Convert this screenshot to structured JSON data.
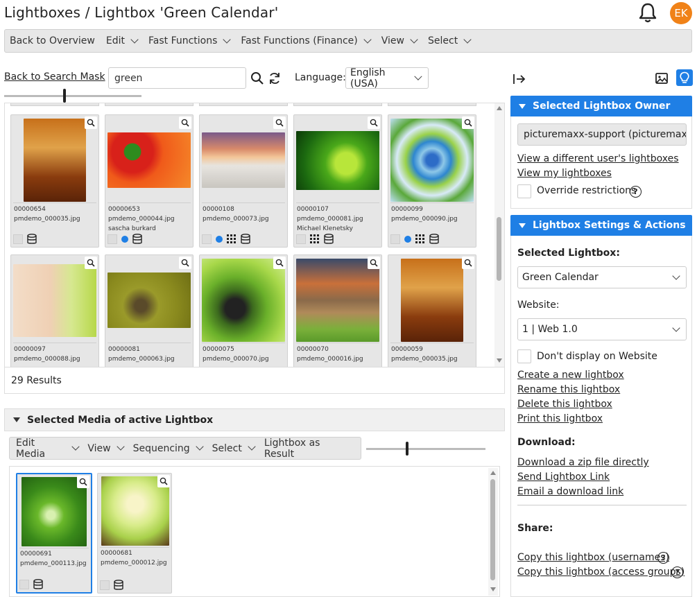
{
  "header": {
    "title": "Lightboxes / Lightbox 'Green Calendar'",
    "avatar_initials": "EK"
  },
  "menubar": [
    {
      "label": "Back to Overview",
      "dropdown": false
    },
    {
      "label": "Edit",
      "dropdown": true
    },
    {
      "label": "Fast Functions",
      "dropdown": true
    },
    {
      "label": "Fast Functions (Finance)",
      "dropdown": true
    },
    {
      "label": "View",
      "dropdown": true
    },
    {
      "label": "Select",
      "dropdown": true
    }
  ],
  "search": {
    "back_link": "Back to Search Mask",
    "value": "green",
    "language_label": "Language:",
    "language_value": "English (USA)"
  },
  "tiles": [
    {
      "id": "00000654",
      "file": "pmdemo_000035.jpg",
      "owner": "",
      "icons": [
        "db"
      ]
    },
    {
      "id": "00000653",
      "file": "pmdemo_000044.jpg",
      "owner": "sascha burkard",
      "icons": [
        "dot",
        "db"
      ]
    },
    {
      "id": "00000108",
      "file": "pmdemo_000073.jpg",
      "owner": "",
      "icons": [
        "dot",
        "grid",
        "db"
      ]
    },
    {
      "id": "00000107",
      "file": "pmdemo_000081.jpg",
      "owner": "Michael Klenetsky",
      "icons": [
        "grid",
        "db"
      ]
    },
    {
      "id": "00000099",
      "file": "pmdemo_000090.jpg",
      "owner": "",
      "icons": [
        "dot",
        "grid",
        "db"
      ]
    },
    {
      "id": "00000097",
      "file": "pmdemo_000088.jpg",
      "owner": "",
      "icons": []
    },
    {
      "id": "00000081",
      "file": "pmdemo_000063.jpg",
      "owner": "",
      "icons": []
    },
    {
      "id": "00000075",
      "file": "pmdemo_000070.jpg",
      "owner": "",
      "icons": []
    },
    {
      "id": "00000070",
      "file": "pmdemo_000016.jpg",
      "owner": "",
      "icons": []
    },
    {
      "id": "00000059",
      "file": "pmdemo_000035.jpg",
      "owner": "",
      "icons": []
    }
  ],
  "results_text": "29 Results",
  "selected_media": {
    "title": "Selected Media of active Lightbox",
    "menu": [
      {
        "label": "Edit Media",
        "dropdown": true
      },
      {
        "label": "View",
        "dropdown": true
      },
      {
        "label": "Sequencing",
        "dropdown": true
      },
      {
        "label": "Select",
        "dropdown": true
      },
      {
        "label": "Lightbox as Result",
        "dropdown": false
      }
    ],
    "tiles": [
      {
        "id": "00000691",
        "file": "pmdemo_000113.jpg",
        "selected": true
      },
      {
        "id": "00000681",
        "file": "pmdemo_000012.jpg",
        "selected": false
      }
    ]
  },
  "owner_panel": {
    "title": "Selected Lightbox Owner",
    "owner_value": "picturemaxx-support (picturemaxx-s",
    "link_other": "View a different user's lightboxes",
    "link_mine": "View my lightboxes",
    "override_label": "Override restrictions"
  },
  "settings_panel": {
    "title": "Lightbox Settings & Actions",
    "selected_label": "Selected Lightbox:",
    "selected_value": "Green Calendar",
    "website_label": "Website:",
    "website_value": "1 | Web 1.0",
    "dont_display_label": "Don't display on Website",
    "actions": [
      "Create a new lightbox",
      "Rename this lightbox",
      "Delete this lightbox",
      "Print this lightbox"
    ],
    "download_label": "Download:",
    "downloads": [
      "Download a zip file directly",
      "Send Lightbox Link",
      "Email a download link"
    ],
    "share_label": "Share:",
    "share_links": [
      "Copy this lightbox (usernames)",
      "Copy this lightbox (access groups)"
    ]
  },
  "colors": {
    "accent": "#1f7fe5",
    "avatar": "#f08218"
  }
}
